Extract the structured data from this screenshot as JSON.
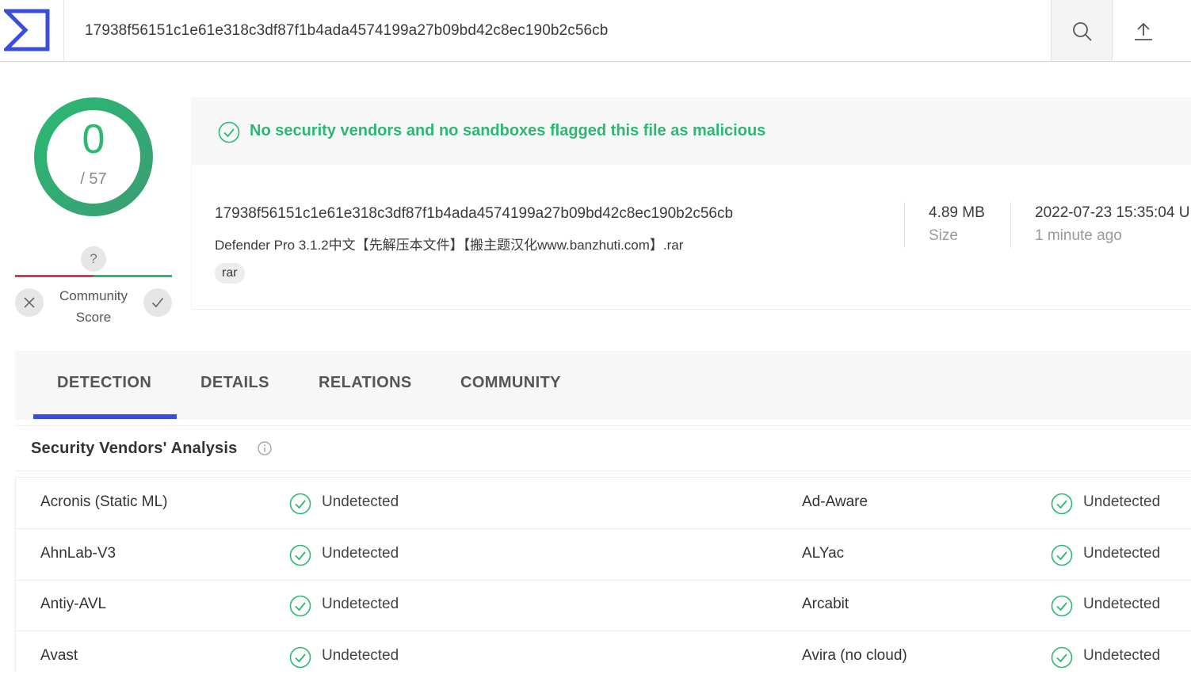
{
  "search": {
    "value": "17938f56151c1e61e318c3df87f1b4ada4574199a27b09bd42c8ec190b2c56cb"
  },
  "score": {
    "detections": "0",
    "total": "/ 57"
  },
  "community": {
    "question": "?",
    "label_line1": "Community",
    "label_line2": "Score"
  },
  "banner": {
    "text": "No security vendors and no sandboxes flagged this file as malicious"
  },
  "file": {
    "hash": "17938f56151c1e61e318c3df87f1b4ada4574199a27b09bd42c8ec190b2c56cb",
    "name": "Defender Pro 3.1.2中文【先解压本文件】【搬主题汉化www.banzhuti.com】.rar",
    "tag": "rar",
    "size_value": "4.89 MB",
    "size_label": "Size",
    "date_value": "2022-07-23 15:35:04 U",
    "date_label": "1 minute ago"
  },
  "tabs": [
    {
      "label": "DETECTION",
      "active": true
    },
    {
      "label": "DETAILS",
      "active": false
    },
    {
      "label": "RELATIONS",
      "active": false
    },
    {
      "label": "COMMUNITY",
      "active": false
    }
  ],
  "analysis": {
    "title": "Security Vendors' Analysis",
    "rows": [
      {
        "left_vendor": "Acronis (Static ML)",
        "left_result": "Undetected",
        "right_vendor": "Ad-Aware",
        "right_result": "Undetected"
      },
      {
        "left_vendor": "AhnLab-V3",
        "left_result": "Undetected",
        "right_vendor": "ALYac",
        "right_result": "Undetected"
      },
      {
        "left_vendor": "Antiy-AVL",
        "left_result": "Undetected",
        "right_vendor": "Arcabit",
        "right_result": "Undetected"
      },
      {
        "left_vendor": "Avast",
        "left_result": "Undetected",
        "right_vendor": "Avira (no cloud)",
        "right_result": "Undetected"
      }
    ]
  },
  "colors": {
    "accent": "#3b4edb",
    "clean": "#2bb873",
    "malicious": "#e5344d"
  },
  "icons": [
    "virustotal-logo-icon",
    "search-icon",
    "upload-icon",
    "close-icon",
    "check-icon",
    "check-circle-icon",
    "info-icon"
  ]
}
